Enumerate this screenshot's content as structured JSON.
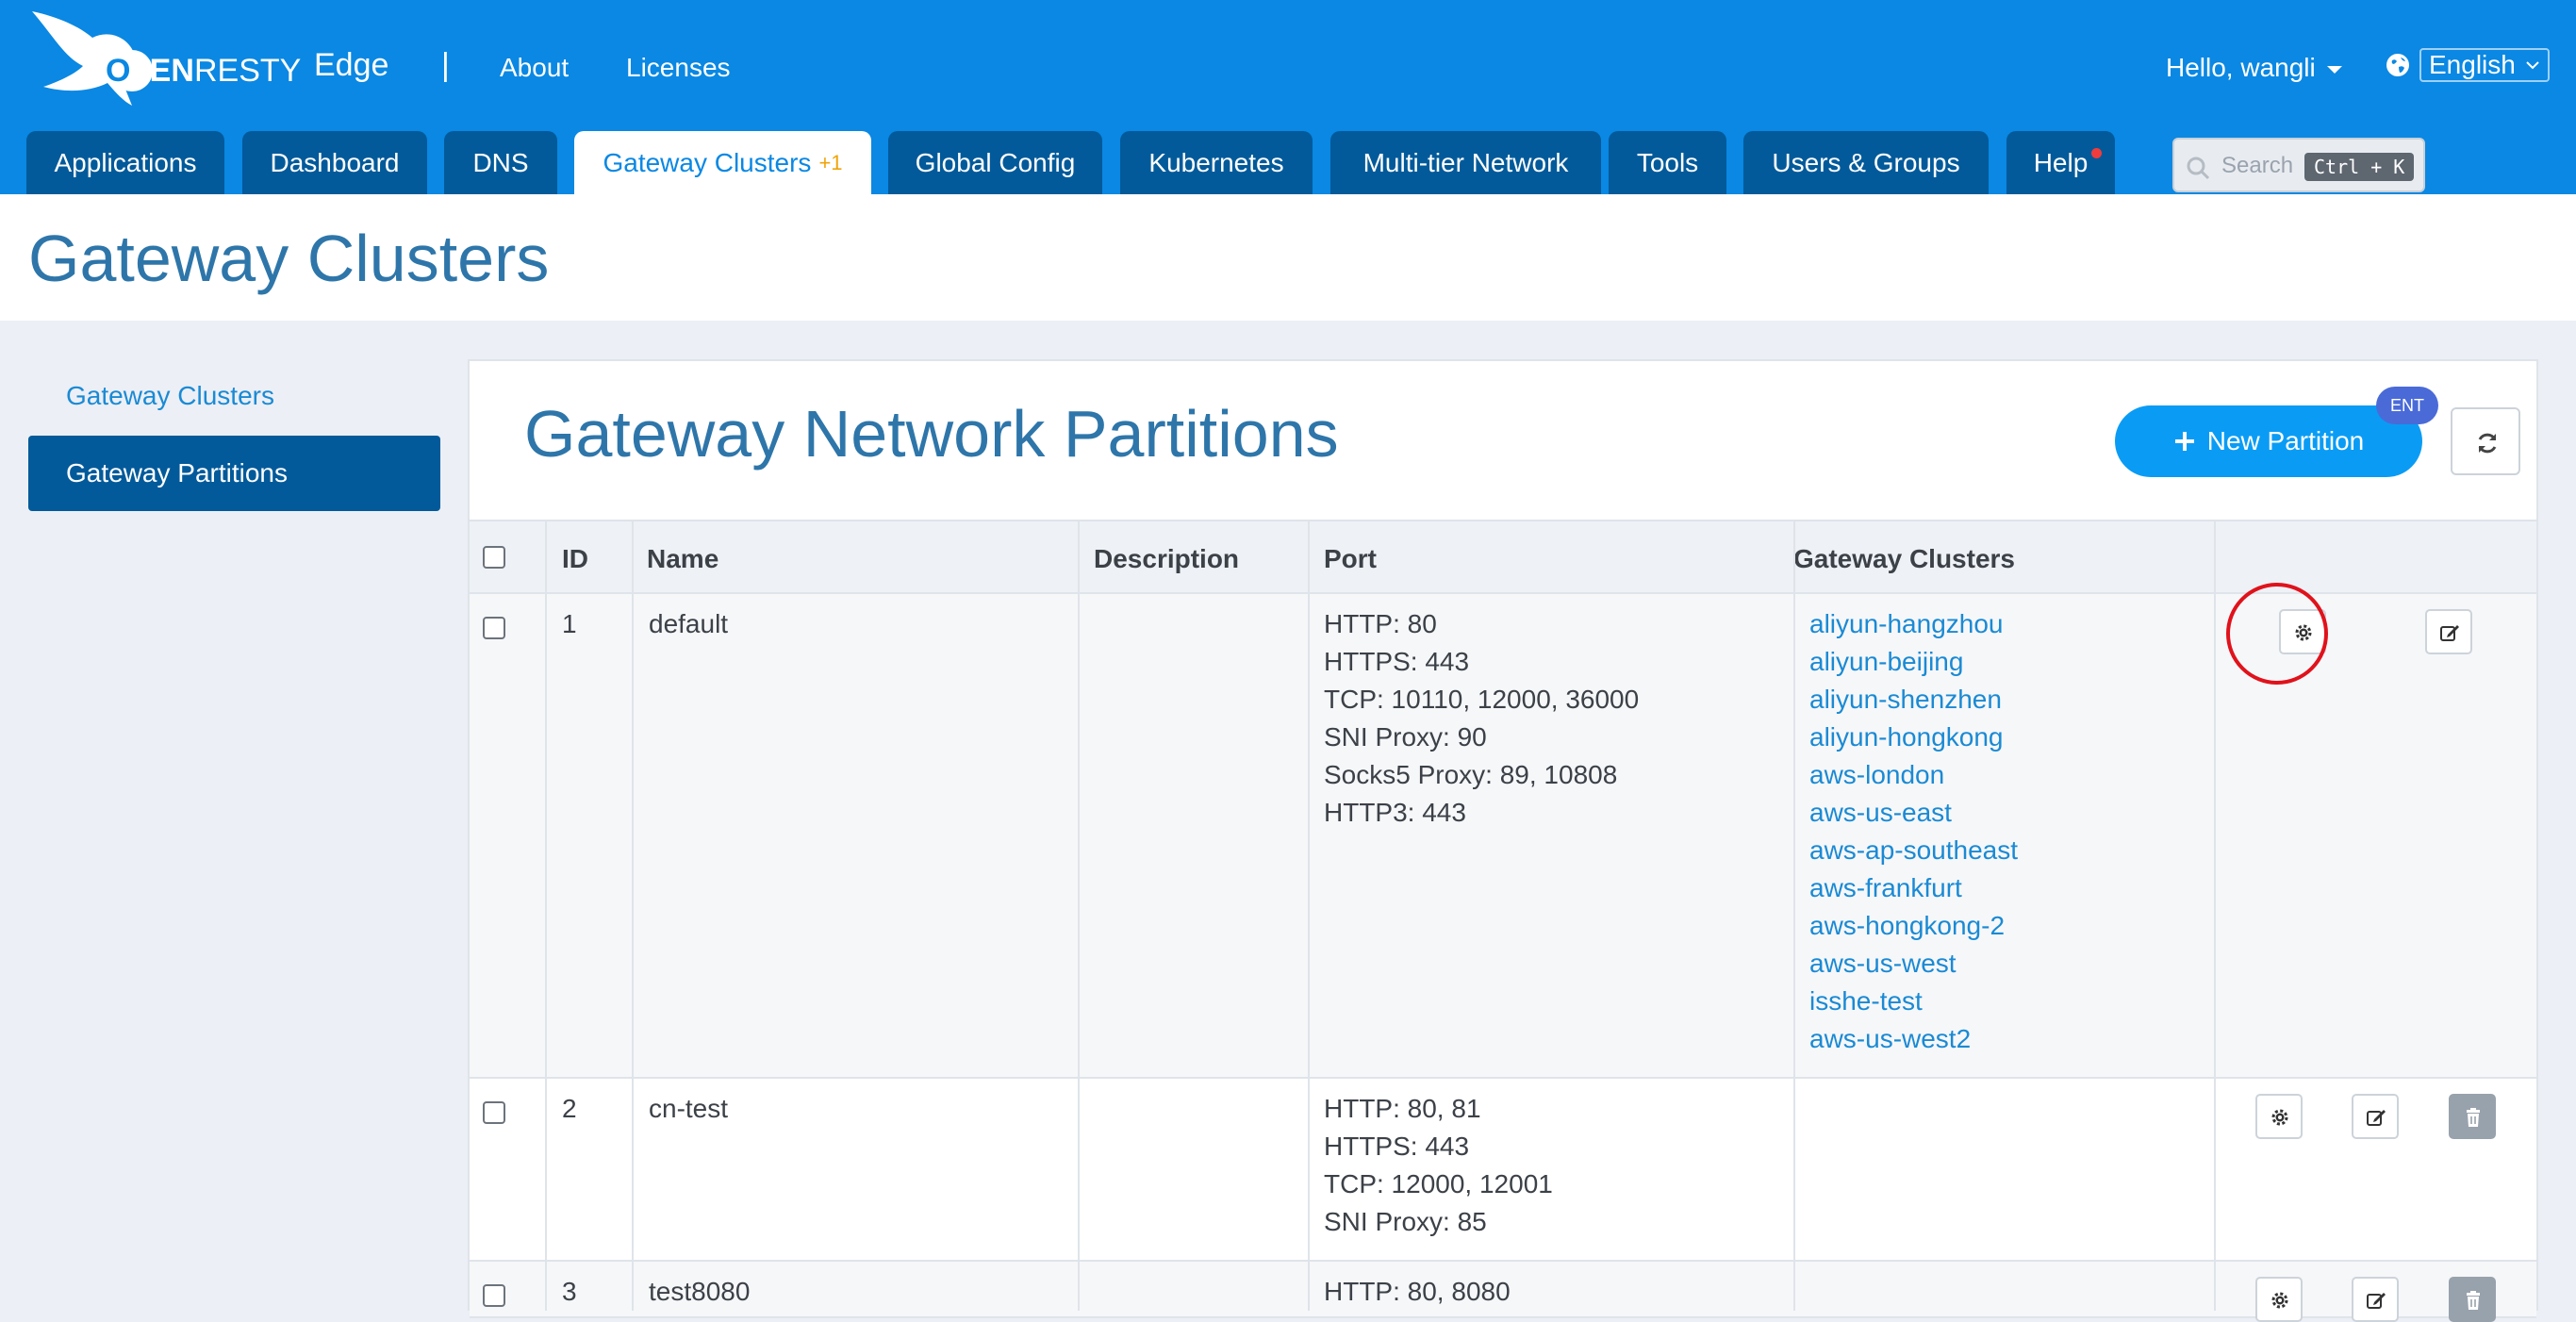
{
  "brand": {
    "logo_text": "OPENRESTY",
    "product": "Edge",
    "separator": "|"
  },
  "top_links": {
    "about": "About",
    "licenses": "Licenses"
  },
  "user": {
    "greeting": "Hello, wangli"
  },
  "language": {
    "selected": "English"
  },
  "nav_tabs": [
    {
      "label": "Applications"
    },
    {
      "label": "Dashboard"
    },
    {
      "label": "DNS"
    },
    {
      "label": "Gateway Clusters",
      "badge": "+1",
      "active": true
    },
    {
      "label": "Global Config"
    },
    {
      "label": "Kubernetes"
    },
    {
      "label": "Multi-tier Network"
    },
    {
      "label": "Tools"
    },
    {
      "label": "Users & Groups"
    },
    {
      "label": "Help"
    }
  ],
  "search": {
    "placeholder": "Search",
    "shortcut": "Ctrl + K"
  },
  "page": {
    "title": "Gateway Clusters"
  },
  "sidebar": {
    "items": [
      {
        "label": "Gateway Clusters"
      },
      {
        "label": "Gateway Partitions",
        "active": true
      }
    ]
  },
  "main": {
    "title": "Gateway Network Partitions",
    "new_button": "New Partition",
    "ent_badge": "ENT"
  },
  "table": {
    "columns": [
      "ID",
      "Name",
      "Description",
      "Port",
      "Gateway Clusters"
    ],
    "rows": [
      {
        "id": "1",
        "name": "default",
        "description": "",
        "ports": [
          "HTTP: 80",
          "HTTPS: 443",
          "TCP: 10110, 12000, 36000",
          "SNI Proxy: 90",
          "Socks5 Proxy: 89, 10808",
          "HTTP3: 443"
        ],
        "clusters": [
          "aliyun-hangzhou",
          "aliyun-beijing",
          "aliyun-shenzhen",
          "aliyun-hongkong",
          "aws-london",
          "aws-us-east",
          "aws-ap-southeast",
          "aws-frankfurt",
          "aws-hongkong-2",
          "aws-us-west",
          "isshe-test",
          "aws-us-west2"
        ]
      },
      {
        "id": "2",
        "name": "cn-test",
        "description": "",
        "ports": [
          "HTTP: 80, 81",
          "HTTPS: 443",
          "TCP: 12000, 12001",
          "SNI Proxy: 85"
        ],
        "clusters": []
      },
      {
        "id": "3",
        "name": "test8080",
        "description": "",
        "ports": [
          "HTTP: 80, 8080"
        ],
        "clusters": []
      }
    ]
  },
  "colors": {
    "header_blue": "#0a88e3",
    "tab_dark": "#025a9a",
    "title_blue": "#2e76aa",
    "link_blue": "#1a8ad4",
    "highlight_red": "#e0121b"
  }
}
